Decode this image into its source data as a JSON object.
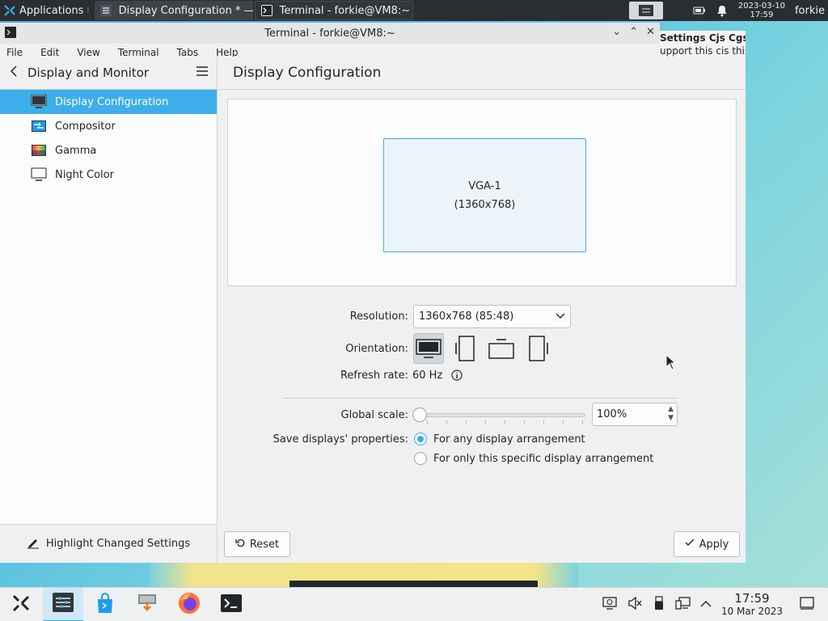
{
  "topbar": {
    "launcher_label": "Applications",
    "tasks": [
      {
        "label": "Display Configuration * —...",
        "icon": "settings-icon"
      },
      {
        "label": "Terminal - forkie@VM8:~",
        "icon": "terminal-icon"
      }
    ],
    "clock_date": "2023-03-10",
    "clock_time": "17:59",
    "user": "forkie"
  },
  "terminal": {
    "title": "Terminal - forkie@VM8:~",
    "menu": [
      "File",
      "Edit",
      "View",
      "Terminal",
      "Tabs",
      "Help"
    ]
  },
  "bg_settings": {
    "line1": "Settings Cjs Cgs C",
    "line2": "upport this cis this"
  },
  "sidebar": {
    "back_title": "Display and Monitor",
    "items": [
      {
        "label": "Display Configuration",
        "icon": "monitor-icon",
        "selected": true
      },
      {
        "label": "Compositor",
        "icon": "compositor-icon"
      },
      {
        "label": "Gamma",
        "icon": "gamma-icon"
      },
      {
        "label": "Night Color",
        "icon": "night-color-icon"
      }
    ],
    "footer_label": "Highlight Changed Settings"
  },
  "main": {
    "title": "Display Configuration",
    "monitor_name": "VGA-1",
    "monitor_res": "(1360x768)",
    "resolution_label": "Resolution:",
    "resolution_value": "1360x768 (85:48)",
    "orientation_label": "Orientation:",
    "refresh_label": "Refresh rate:",
    "refresh_value": "60 Hz",
    "scale_label": "Global scale:",
    "scale_value": "100%",
    "scale_fraction": 0.0,
    "save_label": "Save displays' properties:",
    "save_options": [
      {
        "label": "For any display arrangement",
        "checked": true
      },
      {
        "label": "For only this specific display arrangement",
        "checked": false
      }
    ],
    "reset_label": "Reset",
    "apply_label": "Apply"
  },
  "panel": {
    "time": "17:59",
    "date": "10 Mar 2023"
  },
  "colors": {
    "accent": "#3daee9",
    "topbar_bg": "#2a2e32",
    "window_bg": "#eff0f1"
  }
}
